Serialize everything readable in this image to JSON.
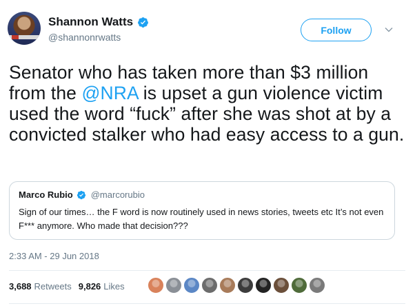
{
  "author": {
    "name": "Shannon Watts",
    "handle": "@shannonrwatts",
    "verified": true,
    "avatar_icon": "profile-photo"
  },
  "follow_button": {
    "label": "Follow"
  },
  "tweet": {
    "text_before": "Senator who has taken more than $3 million from the ",
    "mention": "@NRA",
    "text_after": " is upset a gun violence victim used the word “fuck” after she was shot at by a convicted stalker who had easy access to a gun."
  },
  "quoted_tweet": {
    "name": "Marco Rubio",
    "handle": "@marcorubio",
    "verified": true,
    "text": "Sign of our times… the F word is now routinely used in news stories, tweets etc It’s not even F*** anymore.  Who made that decision???"
  },
  "timestamp": "2:33 AM - 29 Jun 2018",
  "stats": {
    "retweets_count": "3,688",
    "retweets_label": "Retweets",
    "likes_count": "9,826",
    "likes_label": "Likes"
  },
  "likers": [
    {
      "icon": "liker-avatar",
      "color": "#d9825b"
    },
    {
      "icon": "liker-avatar",
      "color": "#8a8f96"
    },
    {
      "icon": "liker-avatar",
      "color": "#5b87c5"
    },
    {
      "icon": "liker-avatar",
      "color": "#6c6c6c"
    },
    {
      "icon": "liker-avatar",
      "color": "#a87b5a"
    },
    {
      "icon": "liker-avatar",
      "color": "#3c3c3c"
    },
    {
      "icon": "liker-avatar",
      "color": "#222222"
    },
    {
      "icon": "liker-avatar",
      "color": "#6b4f3a"
    },
    {
      "icon": "liker-avatar",
      "color": "#4f6b3a"
    },
    {
      "icon": "liker-avatar",
      "color": "#7a7a7a"
    }
  ],
  "colors": {
    "accent": "#1da1f2",
    "text": "#14171a",
    "secondary": "#657786",
    "border": "#ccd6dd"
  }
}
